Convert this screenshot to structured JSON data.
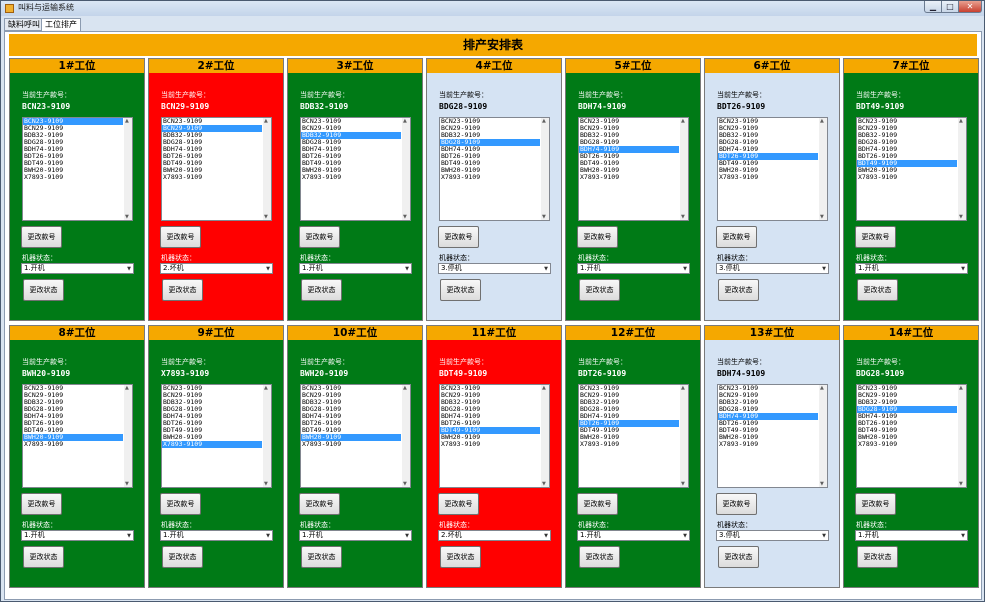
{
  "window": {
    "title": "叫料与运输系统",
    "min_symbol": "▁",
    "max_symbol": "□",
    "close_symbol": "✕"
  },
  "tabs": [
    {
      "label": "缺料呼叫"
    },
    {
      "label": "工位排产"
    }
  ],
  "header": {
    "title": "排产安排表"
  },
  "labels": {
    "current_model": "当前生产款号：",
    "machine_status": "机器状态：",
    "change_model": "更改款号",
    "change_status": "更改状态"
  },
  "model_options": [
    "BCN23-9109",
    "BCN29-9109",
    "BDB32-9109",
    "BDG28-9109",
    "BDH74-9109",
    "BDT26-9109",
    "BDT49-9109",
    "BWH20-9109",
    "X7893-9109"
  ],
  "status_colors": {
    "running": "#007a16",
    "broken": "#ff0000",
    "stopped": "#d5e3f3",
    "header": "#f5a800"
  },
  "stations": [
    {
      "title": "1#工位",
      "model": "BCN23-9109",
      "selected_index": 0,
      "status": "1.开机",
      "color": "green"
    },
    {
      "title": "2#工位",
      "model": "BCN29-9109",
      "selected_index": 1,
      "status": "2.坏机",
      "color": "red"
    },
    {
      "title": "3#工位",
      "model": "BDB32-9109",
      "selected_index": 2,
      "status": "1.开机",
      "color": "green"
    },
    {
      "title": "4#工位",
      "model": "BDG28-9109",
      "selected_index": 3,
      "status": "3.停机",
      "color": "lightblue"
    },
    {
      "title": "5#工位",
      "model": "BDH74-9109",
      "selected_index": 4,
      "status": "1.开机",
      "color": "green"
    },
    {
      "title": "6#工位",
      "model": "BDT26-9109",
      "selected_index": 5,
      "status": "3.停机",
      "color": "lightblue"
    },
    {
      "title": "7#工位",
      "model": "BDT49-9109",
      "selected_index": 6,
      "status": "1.开机",
      "color": "green"
    },
    {
      "title": "8#工位",
      "model": "BWH20-9109",
      "selected_index": 7,
      "status": "1.开机",
      "color": "green"
    },
    {
      "title": "9#工位",
      "model": "X7893-9109",
      "selected_index": 8,
      "status": "1.开机",
      "color": "green"
    },
    {
      "title": "10#工位",
      "model": "BWH20-9109",
      "selected_index": 7,
      "status": "1.开机",
      "color": "green"
    },
    {
      "title": "11#工位",
      "model": "BDT49-9109",
      "selected_index": 6,
      "status": "2.坏机",
      "color": "red"
    },
    {
      "title": "12#工位",
      "model": "BDT26-9109",
      "selected_index": 5,
      "status": "1.开机",
      "color": "green"
    },
    {
      "title": "13#工位",
      "model": "BDH74-9109",
      "selected_index": 4,
      "status": "3.停机",
      "color": "lightblue"
    },
    {
      "title": "14#工位",
      "model": "BDG28-9109",
      "selected_index": 3,
      "status": "1.开机",
      "color": "green"
    }
  ]
}
